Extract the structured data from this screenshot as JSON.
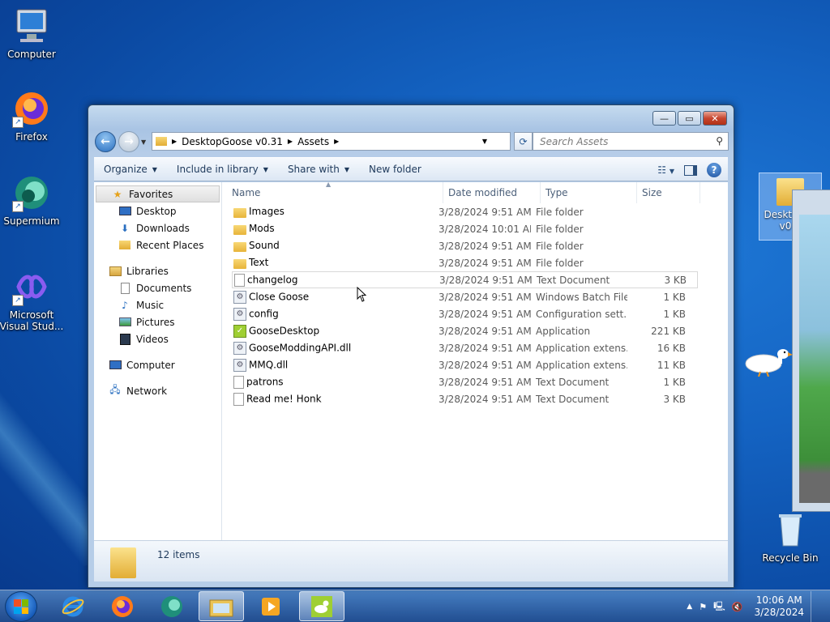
{
  "desktop": {
    "icons": [
      {
        "label": "Computer"
      },
      {
        "label": "Firefox"
      },
      {
        "label": "Supermium"
      },
      {
        "label": "Microsoft Visual Stud..."
      },
      {
        "label": "Recycle Bin"
      }
    ],
    "partial_folder_label": "Deskto e v0"
  },
  "explorer": {
    "breadcrumb": [
      "DesktopGoose v0.31",
      "Assets"
    ],
    "search_placeholder": "Search Assets",
    "toolbar": {
      "organize": "Organize",
      "include_in_library": "Include in library",
      "share_with": "Share with",
      "new_folder": "New folder"
    },
    "nav": {
      "favorites": "Favorites",
      "favorites_items": [
        "Desktop",
        "Downloads",
        "Recent Places"
      ],
      "libraries": "Libraries",
      "libraries_items": [
        "Documents",
        "Music",
        "Pictures",
        "Videos"
      ],
      "computer": "Computer",
      "network": "Network"
    },
    "columns": {
      "name": "Name",
      "date": "Date modified",
      "type": "Type",
      "size": "Size"
    },
    "files": [
      {
        "name": "Images",
        "date": "3/28/2024 9:51 AM",
        "type": "File folder",
        "size": "",
        "icon": "folder-icon"
      },
      {
        "name": "Mods",
        "date": "3/28/2024 10:01 AM",
        "type": "File folder",
        "size": "",
        "icon": "folder-icon"
      },
      {
        "name": "Sound",
        "date": "3/28/2024 9:51 AM",
        "type": "File folder",
        "size": "",
        "icon": "folder-icon"
      },
      {
        "name": "Text",
        "date": "3/28/2024 9:51 AM",
        "type": "File folder",
        "size": "",
        "icon": "folder-icon"
      },
      {
        "name": "changelog",
        "date": "3/28/2024 9:51 AM",
        "type": "Text Document",
        "size": "3 KB",
        "icon": "document-icon"
      },
      {
        "name": "Close Goose",
        "date": "3/28/2024 9:51 AM",
        "type": "Windows Batch File",
        "size": "1 KB",
        "icon": "gear-file-icon"
      },
      {
        "name": "config",
        "date": "3/28/2024 9:51 AM",
        "type": "Configuration sett...",
        "size": "1 KB",
        "icon": "gear-file-icon"
      },
      {
        "name": "GooseDesktop",
        "date": "3/28/2024 9:51 AM",
        "type": "Application",
        "size": "221 KB",
        "icon": "application-icon"
      },
      {
        "name": "GooseModdingAPI.dll",
        "date": "3/28/2024 9:51 AM",
        "type": "Application extens...",
        "size": "16 KB",
        "icon": "gear-file-icon"
      },
      {
        "name": "MMQ.dll",
        "date": "3/28/2024 9:51 AM",
        "type": "Application extens...",
        "size": "11 KB",
        "icon": "gear-file-icon"
      },
      {
        "name": "patrons",
        "date": "3/28/2024 9:51 AM",
        "type": "Text Document",
        "size": "1 KB",
        "icon": "document-icon"
      },
      {
        "name": "Read me! Honk",
        "date": "3/28/2024 9:51 AM",
        "type": "Text Document",
        "size": "3 KB",
        "icon": "document-icon"
      }
    ],
    "status": "12 items"
  },
  "taskbar": {
    "time": "10:06 AM",
    "date": "3/28/2024"
  }
}
